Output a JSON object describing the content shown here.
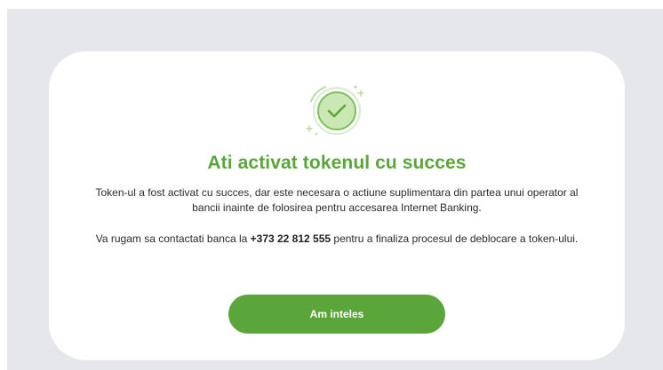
{
  "dialog": {
    "title": "Ati activat tokenul cu succes",
    "description": "Token-ul a fost activat cu succes, dar este necesara o actiune suplimentara din partea unui operator al bancii inainte de folosirea pentru accesarea Internet Banking.",
    "contact_prefix": "Va rugam sa contactati banca la ",
    "phone": "+373 22 812 555",
    "contact_suffix": " pentru a finaliza procesul de deblocare a token-ului.",
    "confirm_label": "Am inteles",
    "icon": "success-check-icon"
  },
  "colors": {
    "accent": "#5aa63a",
    "backdrop": "#e6e7ea",
    "icon_fill": "#c9e8b4"
  }
}
